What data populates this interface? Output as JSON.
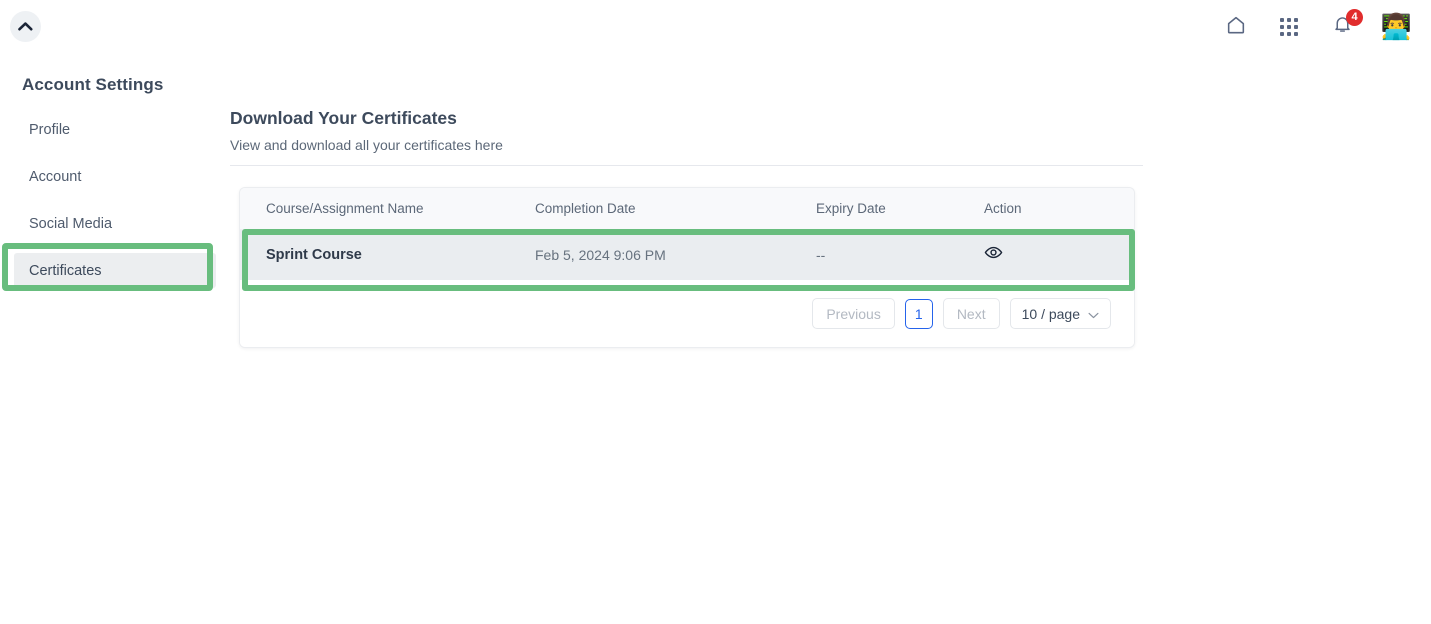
{
  "header": {
    "logo_icon": "chevron-up-icon",
    "home_icon": "home-icon",
    "apps_icon": "apps-grid-icon",
    "notifications_icon": "bell-icon",
    "notifications_count": "4",
    "avatar_icon": "user-avatar",
    "avatar_glyph": "👨‍💻",
    "badge_color": "#e12d2d"
  },
  "sidebar": {
    "title": "Account Settings",
    "items": [
      {
        "label": "Profile",
        "active": false
      },
      {
        "label": "Account",
        "active": false
      },
      {
        "label": "Social Media",
        "active": false
      },
      {
        "label": "Certificates",
        "active": true
      }
    ]
  },
  "main": {
    "title": "Download Your Certificates",
    "subtitle": "View and download all your certificates here",
    "table": {
      "columns": [
        "Course/Assignment Name",
        "Completion Date",
        "Expiry Date",
        "Action"
      ],
      "rows": [
        {
          "name": "Sprint Course",
          "completion_date": "Feb 5, 2024 9:06 PM",
          "expiry_date": "--",
          "action_icon": "eye-icon"
        }
      ]
    },
    "pagination": {
      "previous_label": "Previous",
      "current_page": "1",
      "next_label": "Next",
      "page_size_label": "10 / page",
      "page_size_chevron": "chevron-down-icon"
    }
  },
  "annotations": {
    "highlight_color": "#68bd7e",
    "targets": [
      "sidebar-item-certificates",
      "table-row-sprint-course"
    ]
  }
}
